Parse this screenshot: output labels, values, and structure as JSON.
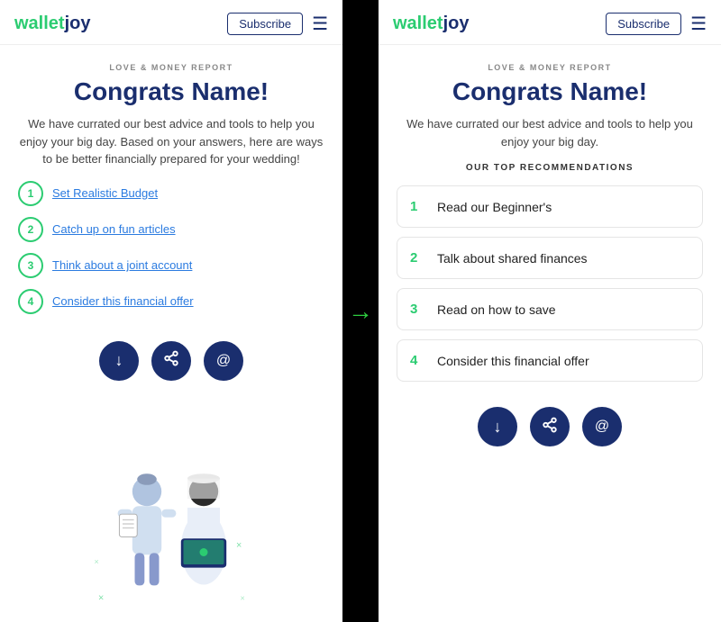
{
  "left": {
    "logo_wallet": "wallet",
    "logo_joy": "joy",
    "subscribe_label": "Subscribe",
    "report_label": "LOVE & MONEY REPORT",
    "congrats_title": "Congrats Name!",
    "subtitle": "We have currated our best advice and tools to help you enjoy your big day. Based on your answers, here are ways to be better financially prepared for your wedding!",
    "list_items": [
      {
        "num": "1",
        "text": "Set Realistic Budget"
      },
      {
        "num": "2",
        "text": "Catch up on fun articles"
      },
      {
        "num": "3",
        "text": "Think about a joint account"
      },
      {
        "num": "4",
        "text": "Consider this financial offer"
      }
    ],
    "btn_download": "⬇",
    "btn_share": "⬆",
    "btn_email": "@"
  },
  "right": {
    "logo_wallet": "wallet",
    "logo_joy": "joy",
    "subscribe_label": "Subscribe",
    "report_label": "LOVE & MONEY REPORT",
    "congrats_title": "Congrats Name!",
    "subtitle": "We have currated our best advice and tools to help you enjoy your big day.",
    "recommendations_label": "OUR TOP RECOMMENDATIONS",
    "rec_items": [
      {
        "num": "1",
        "text": "Read our Beginner's"
      },
      {
        "num": "2",
        "text": "Talk about shared finances"
      },
      {
        "num": "3",
        "text": "Read on how to save"
      },
      {
        "num": "4",
        "text": "Consider this financial offer"
      }
    ],
    "btn_download": "⬇",
    "btn_share": "⬆",
    "btn_email": "@"
  },
  "colors": {
    "brand_blue": "#1a2e6e",
    "brand_green": "#2bcc71",
    "link_blue": "#2b7be0",
    "arrow_green": "#2ecc40"
  }
}
